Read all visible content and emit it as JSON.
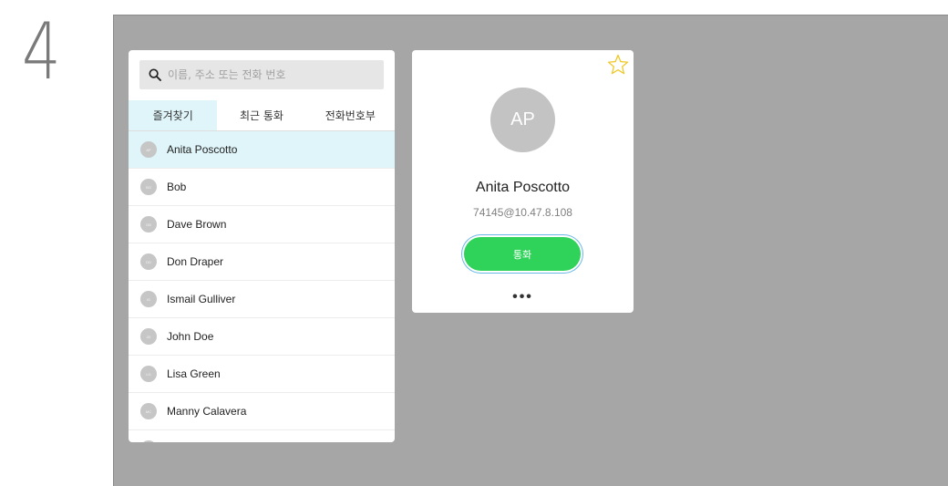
{
  "step": {
    "number": "4"
  },
  "search": {
    "placeholder": "이름, 주소 또는 전화 번호"
  },
  "tabs": [
    {
      "label": "즐겨찾기",
      "active": true
    },
    {
      "label": "최근 통화",
      "active": false
    },
    {
      "label": "전화번호부",
      "active": false
    }
  ],
  "contacts": [
    {
      "initials": "AP",
      "name": "Anita Poscotto",
      "selected": true
    },
    {
      "initials": "BO",
      "name": "Bob"
    },
    {
      "initials": "DB",
      "name": "Dave Brown"
    },
    {
      "initials": "DD",
      "name": "Don Draper"
    },
    {
      "initials": "IG",
      "name": "Ismail Gulliver"
    },
    {
      "initials": "JD",
      "name": "John Doe"
    },
    {
      "initials": "LG",
      "name": "Lisa Green"
    },
    {
      "initials": "MC",
      "name": "Manny Calavera"
    }
  ],
  "detail": {
    "initials": "AP",
    "name": "Anita Poscotto",
    "address": "74145@10.47.8.108",
    "call_label": "통화",
    "more_label": "•••"
  },
  "colors": {
    "screen_bg": "#a6a6a6",
    "selected_bg": "#dff5fa",
    "call_green": "#2fd35a",
    "star_yellow": "#f0c419"
  },
  "icons": {
    "search": "search-icon",
    "favorite": "star-icon"
  }
}
